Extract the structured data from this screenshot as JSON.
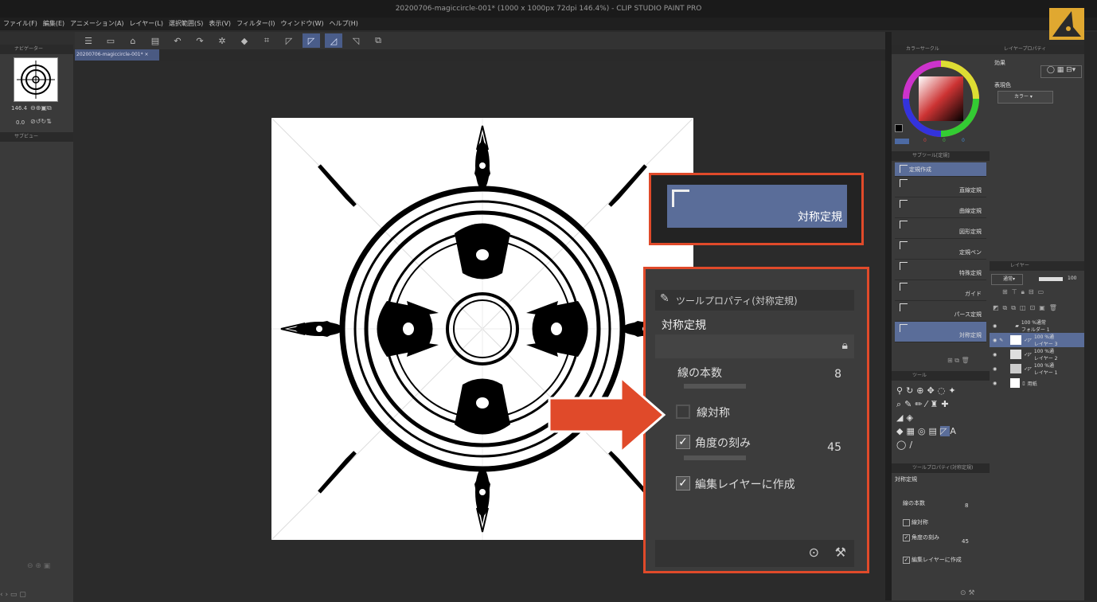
{
  "window": {
    "title": "20200706-magiccircle-001* (1000 x 1000px 72dpi 146.4%)  -  CLIP STUDIO PAINT PRO"
  },
  "menu": [
    "ファイル(F)",
    "編集(E)",
    "アニメーション(A)",
    "レイヤー(L)",
    "選択範囲(S)",
    "表示(V)",
    "フィルター(I)",
    "ウィンドウ(W)",
    "ヘルプ(H)"
  ],
  "left": {
    "navigator_title": "ナビゲーター",
    "zoom": "146.4",
    "angle": "0.0",
    "subview_title": "サブビュー",
    "status_zoom": "146.4"
  },
  "document_tab": "20200706-magiccircle-001*",
  "callout1": {
    "label": "対称定規"
  },
  "callout2": {
    "panel_title": "ツールプロパティ(対称定規)",
    "tool_name": "対称定規",
    "lines_label": "線の本数",
    "lines_value": "8",
    "line_symmetry_label": "線対称",
    "line_symmetry_checked": false,
    "angle_step_label": "角度の刻み",
    "angle_step_checked": true,
    "angle_step_value": "45",
    "create_on_edit_layer_label": "編集レイヤーに作成",
    "create_on_edit_layer_checked": true
  },
  "color_panel": {
    "title": "カラーサークル",
    "values": [
      "0",
      "0",
      "0"
    ]
  },
  "subtool_panel": {
    "title": "サブツール[定規]",
    "items": [
      {
        "label": "定規作成",
        "selected": true
      },
      {
        "label": "直線定規",
        "selected": false
      },
      {
        "label": "曲線定規",
        "selected": false
      },
      {
        "label": "図形定規",
        "selected": false
      },
      {
        "label": "定規ペン",
        "selected": false
      },
      {
        "label": "特殊定規",
        "selected": false
      },
      {
        "label": "ガイド",
        "selected": false
      },
      {
        "label": "パース定規",
        "selected": false
      },
      {
        "label": "対称定規",
        "selected": true
      }
    ]
  },
  "tool_panel": {
    "title": "ツール"
  },
  "small_props": {
    "title": "ツールプロパティ(対称定規)",
    "tool_name": "対称定規",
    "lines_label": "線の本数",
    "lines_value": "8",
    "line_symmetry_label": "線対称",
    "angle_step_label": "角度の刻み",
    "angle_step_value": "45",
    "create_on_edit_layer_label": "編集レイヤーに作成"
  },
  "layer_property": {
    "title": "レイヤープロパティ",
    "effect_label": "効果",
    "display_color_label": "表現色",
    "display_color_value": "カラー"
  },
  "layer_panel": {
    "title": "レイヤー",
    "blend_mode": "通常",
    "opacity": "100",
    "layers": [
      {
        "name": "100 %通常\nフォルダー 1",
        "selected": false
      },
      {
        "name": "100 %通\nレイヤー 3",
        "selected": true
      },
      {
        "name": "100 %通\nレイヤー 2",
        "selected": false
      },
      {
        "name": "100 %通\nレイヤー 1",
        "selected": false
      },
      {
        "name": "用紙",
        "selected": false
      }
    ]
  },
  "colors": {
    "accent": "#e04a2a",
    "selection": "#5a6d99",
    "panel": "#3a3a3a",
    "background": "#2b2b2b"
  }
}
